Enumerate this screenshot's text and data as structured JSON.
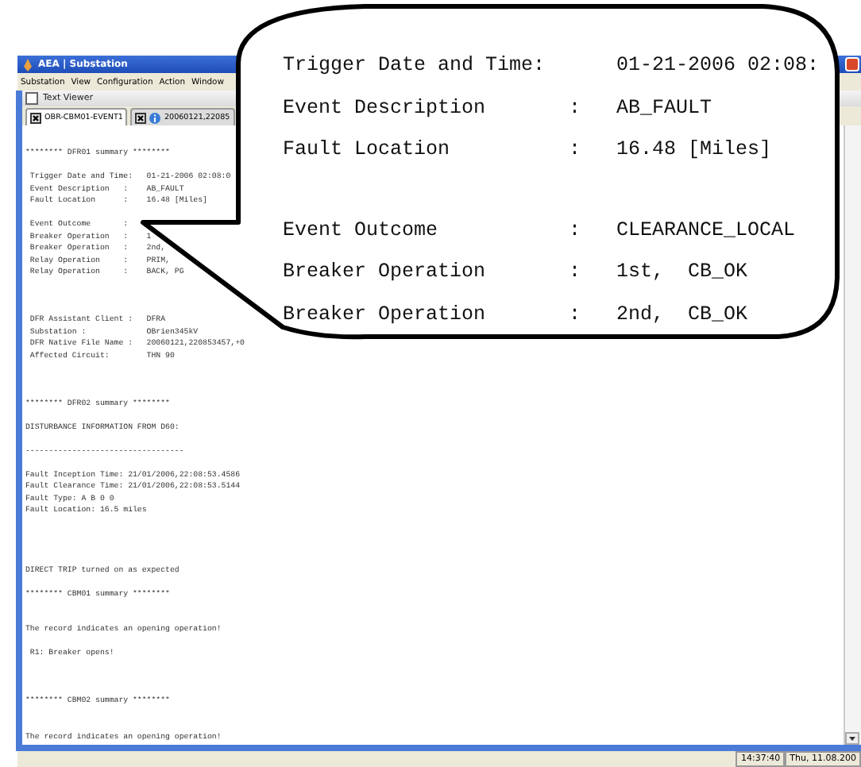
{
  "window": {
    "title": "AEA | Substation"
  },
  "menu": [
    "Substation",
    "View",
    "Configuration",
    "Action",
    "Window"
  ],
  "viewer": {
    "title": "Text Viewer",
    "tabs": [
      {
        "label": "OBR-CBM01-EVENT1",
        "selected": true,
        "info": false
      },
      {
        "label": "20060121,22085",
        "selected": false,
        "info": true
      }
    ],
    "lines": [
      {
        "kind": "text",
        "text": "******** DFR01 summary ********"
      },
      {
        "kind": "blank"
      },
      {
        "kind": "text",
        "text": " Trigger Date and Time:   01-21-2006 02:08:0"
      },
      {
        "kind": "text",
        "text": " Event Description   :    AB_FAULT"
      },
      {
        "kind": "text",
        "text": " Fault Location      :    16.48 [Miles]"
      },
      {
        "kind": "blank"
      },
      {
        "kind": "text",
        "text": " Event Outcome       :"
      },
      {
        "kind": "text",
        "text": " Breaker Operation   :    1"
      },
      {
        "kind": "text",
        "text": " Breaker Operation   :    2nd,"
      },
      {
        "kind": "text",
        "text": " Relay Operation     :    PRIM,"
      },
      {
        "kind": "text",
        "text": " Relay Operation     :    BACK, PG"
      },
      {
        "kind": "blank"
      },
      {
        "kind": "blank"
      },
      {
        "kind": "blank"
      },
      {
        "kind": "text",
        "text": " DFR Assistant Client :   DFRA"
      },
      {
        "kind": "text",
        "text": " Substation :             OBrien345kV"
      },
      {
        "kind": "text",
        "text": " DFR Native File Name :   20060121,220853457,+0"
      },
      {
        "kind": "text",
        "text": " Affected Circuit:        THN 90"
      },
      {
        "kind": "blank"
      },
      {
        "kind": "blank"
      },
      {
        "kind": "blank"
      },
      {
        "kind": "text",
        "text": "******** DFR02 summary ********"
      },
      {
        "kind": "blank"
      },
      {
        "kind": "text",
        "text": "DISTURBANCE INFORMATION FROM D60:"
      },
      {
        "kind": "blank"
      },
      {
        "kind": "text",
        "text": "----------------------------------"
      },
      {
        "kind": "blank"
      },
      {
        "kind": "text",
        "text": "Fault Inception Time: 21/01/2006,22:08:53.4586"
      },
      {
        "kind": "text",
        "text": "Fault Clearance Time: 21/01/2006,22:08:53.5144"
      },
      {
        "kind": "text",
        "text": "Fault Type: A B 0 0"
      },
      {
        "kind": "text",
        "text": "Fault Location: 16.5 miles"
      },
      {
        "kind": "blank"
      },
      {
        "kind": "blank"
      },
      {
        "kind": "blank"
      },
      {
        "kind": "blank"
      },
      {
        "kind": "text",
        "text": "DIRECT TRIP turned on as expected"
      },
      {
        "kind": "blank"
      },
      {
        "kind": "text",
        "text": "******** CBM01 summary ********"
      },
      {
        "kind": "blank"
      },
      {
        "kind": "blank"
      },
      {
        "kind": "text",
        "text": "The record indicates an opening operation!"
      },
      {
        "kind": "blank"
      },
      {
        "kind": "text",
        "text": " R1: Breaker opens!"
      },
      {
        "kind": "blank"
      },
      {
        "kind": "blank"
      },
      {
        "kind": "blank"
      },
      {
        "kind": "text",
        "text": "******** CBM02 summary ********"
      },
      {
        "kind": "blank"
      },
      {
        "kind": "blank"
      },
      {
        "kind": "text",
        "text": "The record indicates an opening operation!"
      }
    ]
  },
  "status_bar": {
    "time": "14:37:40",
    "date": "Thu, 11.08.200"
  },
  "callout": {
    "rows": [
      {
        "kind": "text",
        "label": "Trigger Date and Time:",
        "value": "01-21-2006 02:08:"
      },
      {
        "kind": "text",
        "label": "Event Description",
        "sep": ":",
        "value": "AB_FAULT"
      },
      {
        "kind": "text",
        "label": "Fault Location",
        "sep": ":",
        "value": "16.48 [Miles]"
      },
      {
        "kind": "blank"
      },
      {
        "kind": "text",
        "label": "Event Outcome",
        "sep": ":",
        "value": "CLEARANCE_LOCAL"
      },
      {
        "kind": "text",
        "label": "Breaker Operation",
        "sep": ":",
        "value": "1st,  CB_OK"
      },
      {
        "kind": "text",
        "label": "Breaker Operation",
        "sep": ":",
        "value": "2nd,  CB_OK"
      }
    ]
  }
}
